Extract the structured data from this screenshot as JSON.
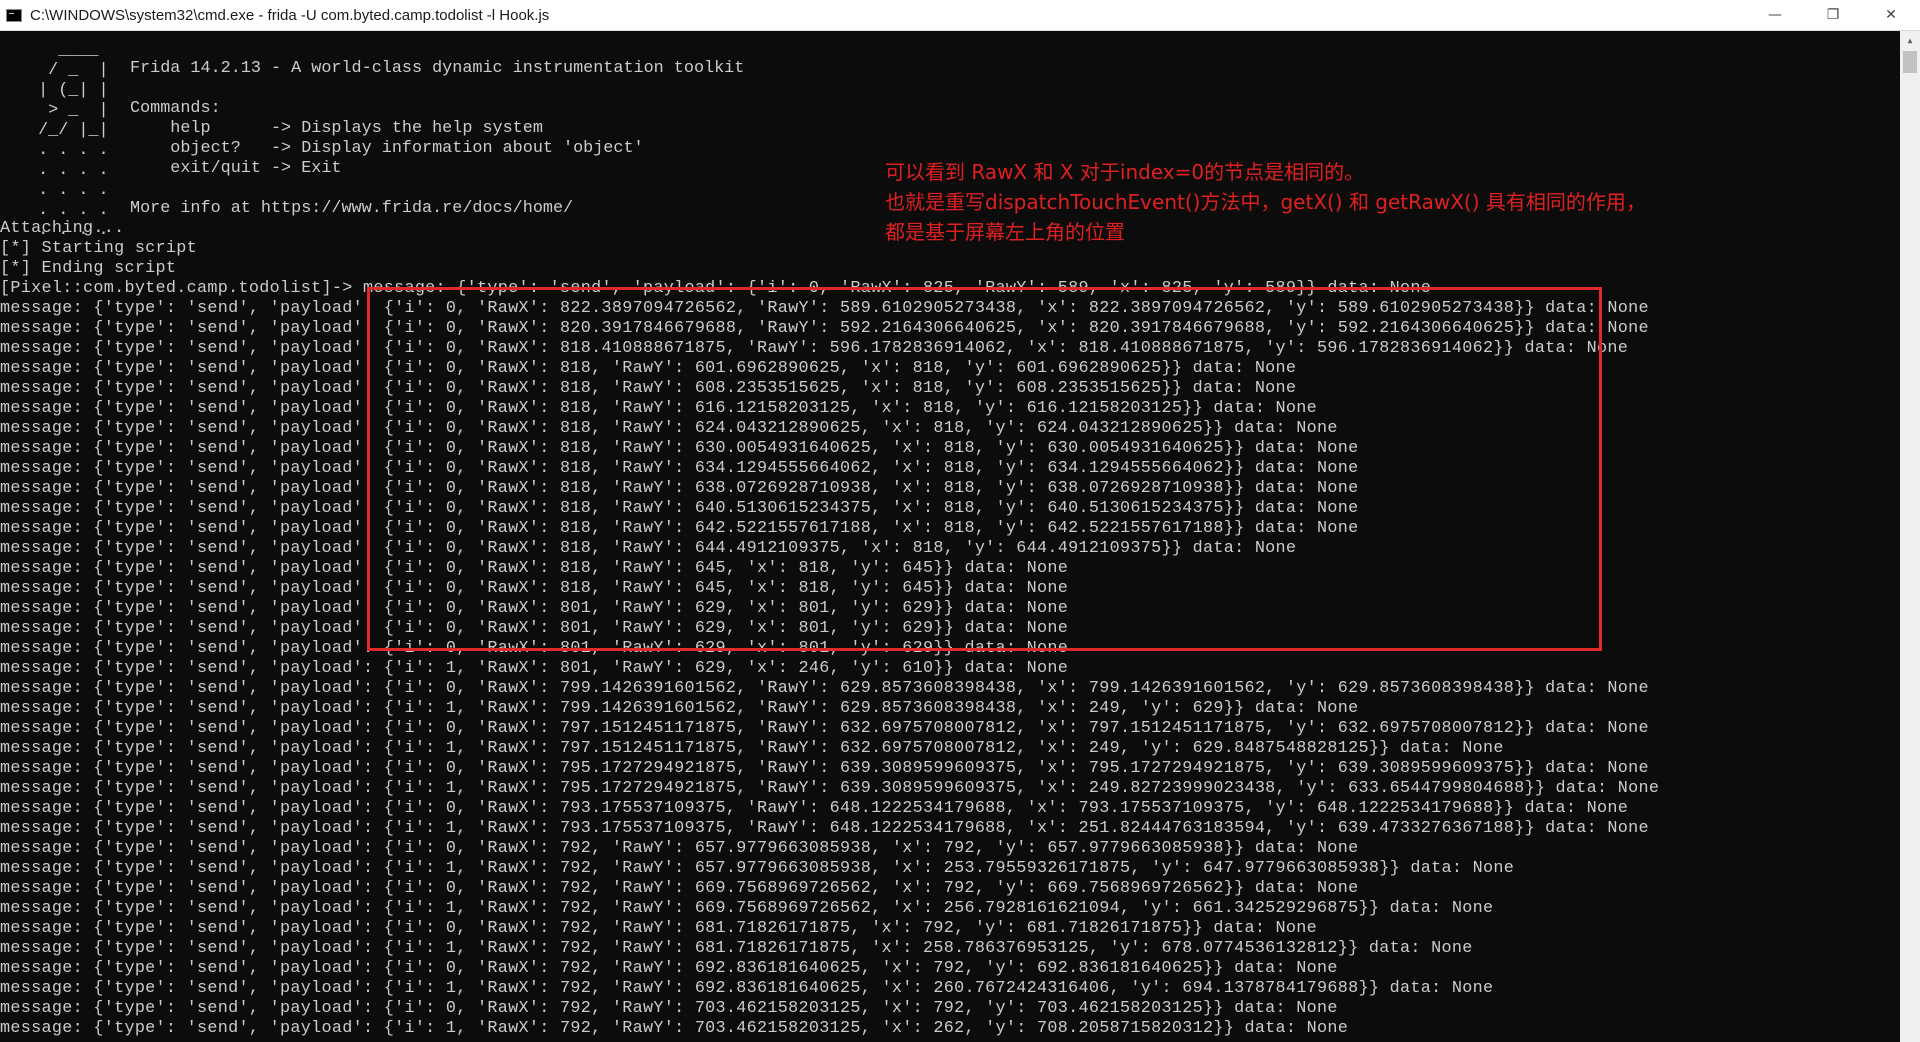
{
  "window": {
    "title": "C:\\WINDOWS\\system32\\cmd.exe - frida  -U com.byted.camp.todolist -l Hook.js",
    "icon": "cmd-icon",
    "controls": {
      "minimize": "—",
      "maximize": "❐",
      "close": "✕"
    }
  },
  "banner": {
    "logo": [
      "   ____",
      "  / _  |",
      " | (_| |",
      "  > _  |",
      " /_/ |_|",
      " . . . .",
      " . . . .",
      " . . . .",
      " . . . .",
      " . . . ."
    ],
    "text": [
      "Frida 14.2.13 - A world-class dynamic instrumentation toolkit",
      "",
      "Commands:",
      "    help      -> Displays the help system",
      "    object?   -> Display information about 'object'",
      "    exit/quit -> Exit",
      "",
      "More info at https://www.frida.re/docs/home/"
    ]
  },
  "status_lines": [
    "Attaching...",
    "[*] Starting script",
    "[*] Ending script"
  ],
  "prompt_line": "[Pixel::com.byted.camp.todolist]-> message: {'type': 'send', 'payload': {'i': 0, 'RawX': 825, 'RawY': 589, 'x': 825, 'y': 589}} data: None",
  "messages": [
    "message: {'type': 'send', 'payload': {'i': 0, 'RawX': 822.3897094726562, 'RawY': 589.6102905273438, 'x': 822.3897094726562, 'y': 589.6102905273438}} data: None",
    "message: {'type': 'send', 'payload': {'i': 0, 'RawX': 820.3917846679688, 'RawY': 592.2164306640625, 'x': 820.3917846679688, 'y': 592.2164306640625}} data: None",
    "message: {'type': 'send', 'payload': {'i': 0, 'RawX': 818.410888671875, 'RawY': 596.1782836914062, 'x': 818.410888671875, 'y': 596.1782836914062}} data: None",
    "message: {'type': 'send', 'payload': {'i': 0, 'RawX': 818, 'RawY': 601.6962890625, 'x': 818, 'y': 601.6962890625}} data: None",
    "message: {'type': 'send', 'payload': {'i': 0, 'RawX': 818, 'RawY': 608.2353515625, 'x': 818, 'y': 608.2353515625}} data: None",
    "message: {'type': 'send', 'payload': {'i': 0, 'RawX': 818, 'RawY': 616.12158203125, 'x': 818, 'y': 616.12158203125}} data: None",
    "message: {'type': 'send', 'payload': {'i': 0, 'RawX': 818, 'RawY': 624.043212890625, 'x': 818, 'y': 624.043212890625}} data: None",
    "message: {'type': 'send', 'payload': {'i': 0, 'RawX': 818, 'RawY': 630.0054931640625, 'x': 818, 'y': 630.0054931640625}} data: None",
    "message: {'type': 'send', 'payload': {'i': 0, 'RawX': 818, 'RawY': 634.1294555664062, 'x': 818, 'y': 634.1294555664062}} data: None",
    "message: {'type': 'send', 'payload': {'i': 0, 'RawX': 818, 'RawY': 638.0726928710938, 'x': 818, 'y': 638.0726928710938}} data: None",
    "message: {'type': 'send', 'payload': {'i': 0, 'RawX': 818, 'RawY': 640.5130615234375, 'x': 818, 'y': 640.5130615234375}} data: None",
    "message: {'type': 'send', 'payload': {'i': 0, 'RawX': 818, 'RawY': 642.5221557617188, 'x': 818, 'y': 642.5221557617188}} data: None",
    "message: {'type': 'send', 'payload': {'i': 0, 'RawX': 818, 'RawY': 644.4912109375, 'x': 818, 'y': 644.4912109375}} data: None",
    "message: {'type': 'send', 'payload': {'i': 0, 'RawX': 818, 'RawY': 645, 'x': 818, 'y': 645}} data: None",
    "message: {'type': 'send', 'payload': {'i': 0, 'RawX': 818, 'RawY': 645, 'x': 818, 'y': 645}} data: None",
    "message: {'type': 'send', 'payload': {'i': 0, 'RawX': 801, 'RawY': 629, 'x': 801, 'y': 629}} data: None",
    "message: {'type': 'send', 'payload': {'i': 0, 'RawX': 801, 'RawY': 629, 'x': 801, 'y': 629}} data: None",
    "message: {'type': 'send', 'payload': {'i': 0, 'RawX': 801, 'RawY': 629, 'x': 801, 'y': 629}} data: None",
    "message: {'type': 'send', 'payload': {'i': 1, 'RawX': 801, 'RawY': 629, 'x': 246, 'y': 610}} data: None",
    "message: {'type': 'send', 'payload': {'i': 0, 'RawX': 799.1426391601562, 'RawY': 629.8573608398438, 'x': 799.1426391601562, 'y': 629.8573608398438}} data: None",
    "message: {'type': 'send', 'payload': {'i': 1, 'RawX': 799.1426391601562, 'RawY': 629.8573608398438, 'x': 249, 'y': 629}} data: None",
    "message: {'type': 'send', 'payload': {'i': 0, 'RawX': 797.1512451171875, 'RawY': 632.6975708007812, 'x': 797.1512451171875, 'y': 632.6975708007812}} data: None",
    "message: {'type': 'send', 'payload': {'i': 1, 'RawX': 797.1512451171875, 'RawY': 632.6975708007812, 'x': 249, 'y': 629.8487548828125}} data: None",
    "message: {'type': 'send', 'payload': {'i': 0, 'RawX': 795.1727294921875, 'RawY': 639.3089599609375, 'x': 795.1727294921875, 'y': 639.3089599609375}} data: None",
    "message: {'type': 'send', 'payload': {'i': 1, 'RawX': 795.1727294921875, 'RawY': 639.3089599609375, 'x': 249.82723999023438, 'y': 633.6544799804688}} data: None",
    "message: {'type': 'send', 'payload': {'i': 0, 'RawX': 793.175537109375, 'RawY': 648.1222534179688, 'x': 793.175537109375, 'y': 648.1222534179688}} data: None",
    "message: {'type': 'send', 'payload': {'i': 1, 'RawX': 793.175537109375, 'RawY': 648.1222534179688, 'x': 251.82444763183594, 'y': 639.4733276367188}} data: None",
    "message: {'type': 'send', 'payload': {'i': 0, 'RawX': 792, 'RawY': 657.9779663085938, 'x': 792, 'y': 657.9779663085938}} data: None",
    "message: {'type': 'send', 'payload': {'i': 1, 'RawX': 792, 'RawY': 657.9779663085938, 'x': 253.79559326171875, 'y': 647.9779663085938}} data: None",
    "message: {'type': 'send', 'payload': {'i': 0, 'RawX': 792, 'RawY': 669.7568969726562, 'x': 792, 'y': 669.7568969726562}} data: None",
    "message: {'type': 'send', 'payload': {'i': 1, 'RawX': 792, 'RawY': 669.7568969726562, 'x': 256.7928161621094, 'y': 661.342529296875}} data: None",
    "message: {'type': 'send', 'payload': {'i': 0, 'RawX': 792, 'RawY': 681.71826171875, 'x': 792, 'y': 681.71826171875}} data: None",
    "message: {'type': 'send', 'payload': {'i': 1, 'RawX': 792, 'RawY': 681.71826171875, 'x': 258.786376953125, 'y': 678.0774536132812}} data: None",
    "message: {'type': 'send', 'payload': {'i': 0, 'RawX': 792, 'RawY': 692.836181640625, 'x': 792, 'y': 692.836181640625}} data: None",
    "message: {'type': 'send', 'payload': {'i': 1, 'RawX': 792, 'RawY': 692.836181640625, 'x': 260.7672424316406, 'y': 694.1378784179688}} data: None",
    "message: {'type': 'send', 'payload': {'i': 0, 'RawX': 792, 'RawY': 703.462158203125, 'x': 792, 'y': 703.462158203125}} data: None",
    "message: {'type': 'send', 'payload': {'i': 1, 'RawX': 792, 'RawY': 703.462158203125, 'x': 262, 'y': 708.2058715820312}} data: None"
  ],
  "annotation": {
    "lines": [
      "可以看到 RawX 和 X 对于index=0的节点是相同的。",
      "也就是重写dispatchTouchEvent()方法中，getX() 和 getRawX() 具有相同的作用，",
      "都是基于屏幕左上角的位置"
    ],
    "color": "#e02020"
  },
  "colors": {
    "console_bg": "#0c0c0c",
    "console_text": "#cccccc",
    "highlight_box": "#e02a2a"
  }
}
